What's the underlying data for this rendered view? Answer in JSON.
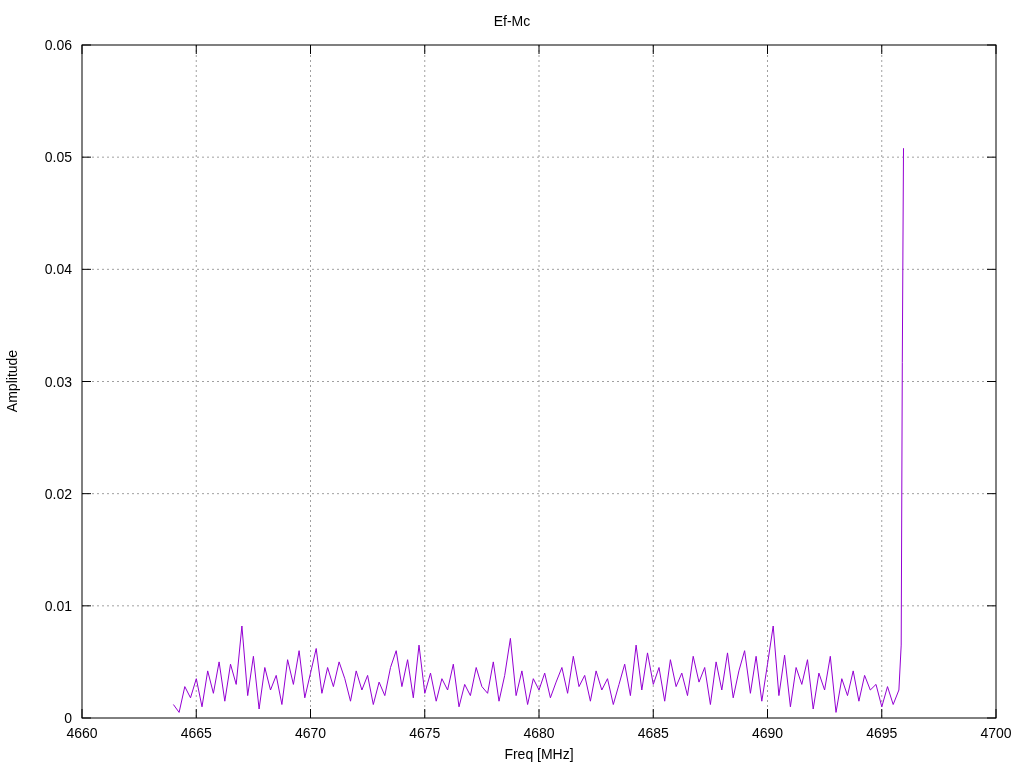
{
  "chart": {
    "chart_data": {
      "type": "line",
      "title": "Ef-Mc",
      "xlabel": "Freq [MHz]",
      "ylabel": "Amplitude",
      "grid": true,
      "xlim": [
        4660,
        4700
      ],
      "ylim": [
        0,
        0.06
      ],
      "xticks": [
        4660,
        4665,
        4670,
        4675,
        4680,
        4685,
        4690,
        4695,
        4700
      ],
      "yticks": [
        0,
        0.01,
        0.02,
        0.03,
        0.04,
        0.05,
        0.06
      ],
      "x": [
        4664,
        4664.25,
        4664.5,
        4664.75,
        4665,
        4665.25,
        4665.5,
        4665.75,
        4666,
        4666.25,
        4666.5,
        4666.75,
        4667,
        4667.25,
        4667.5,
        4667.75,
        4668,
        4668.25,
        4668.5,
        4668.75,
        4669,
        4669.25,
        4669.5,
        4669.75,
        4670,
        4670.25,
        4670.5,
        4670.75,
        4671,
        4671.25,
        4671.5,
        4671.75,
        4672,
        4672.25,
        4672.5,
        4672.75,
        4673,
        4673.25,
        4673.5,
        4673.75,
        4674,
        4674.25,
        4674.5,
        4674.75,
        4675,
        4675.25,
        4675.5,
        4675.75,
        4676,
        4676.25,
        4676.5,
        4676.75,
        4677,
        4677.25,
        4677.5,
        4677.75,
        4678,
        4678.25,
        4678.5,
        4678.75,
        4679,
        4679.25,
        4679.5,
        4679.75,
        4680,
        4680.25,
        4680.5,
        4680.75,
        4681,
        4681.25,
        4681.5,
        4681.75,
        4682,
        4682.25,
        4682.5,
        4682.75,
        4683,
        4683.25,
        4683.5,
        4683.75,
        4684,
        4684.25,
        4684.5,
        4684.75,
        4685,
        4685.25,
        4685.5,
        4685.75,
        4686,
        4686.25,
        4686.5,
        4686.75,
        4687,
        4687.25,
        4687.5,
        4687.75,
        4688,
        4688.25,
        4688.5,
        4688.75,
        4689,
        4689.25,
        4689.5,
        4689.75,
        4690,
        4690.25,
        4690.5,
        4690.75,
        4691,
        4691.25,
        4691.5,
        4691.75,
        4692,
        4692.25,
        4692.5,
        4692.75,
        4693,
        4693.25,
        4693.5,
        4693.75,
        4694,
        4694.25,
        4694.5,
        4694.75,
        4695,
        4695.25,
        4695.5,
        4695.75,
        4695.85,
        4695.9,
        4695.95
      ],
      "series": [
        {
          "color": "#9400d3",
          "values": [
            0.0012,
            0.0005,
            0.0028,
            0.0018,
            0.0035,
            0.001,
            0.0042,
            0.0022,
            0.005,
            0.0015,
            0.0048,
            0.003,
            0.0082,
            0.002,
            0.0055,
            0.0008,
            0.0045,
            0.0025,
            0.0038,
            0.0012,
            0.0052,
            0.003,
            0.006,
            0.0018,
            0.004,
            0.0062,
            0.0022,
            0.0045,
            0.0028,
            0.005,
            0.0035,
            0.0015,
            0.0042,
            0.0025,
            0.0038,
            0.0012,
            0.0032,
            0.002,
            0.0045,
            0.006,
            0.0028,
            0.0052,
            0.0018,
            0.0065,
            0.0022,
            0.004,
            0.0015,
            0.0035,
            0.0025,
            0.0048,
            0.001,
            0.003,
            0.002,
            0.0045,
            0.0028,
            0.0022,
            0.005,
            0.0015,
            0.0038,
            0.0071,
            0.002,
            0.0042,
            0.0012,
            0.0035,
            0.0025,
            0.004,
            0.0018,
            0.0032,
            0.0045,
            0.0022,
            0.0055,
            0.0028,
            0.0038,
            0.0015,
            0.0042,
            0.0025,
            0.0035,
            0.0012,
            0.003,
            0.0048,
            0.002,
            0.0065,
            0.0025,
            0.0058,
            0.003,
            0.0045,
            0.0015,
            0.0052,
            0.0028,
            0.004,
            0.002,
            0.0055,
            0.0032,
            0.0045,
            0.0012,
            0.005,
            0.0025,
            0.0058,
            0.0018,
            0.0042,
            0.006,
            0.0022,
            0.0055,
            0.0015,
            0.0048,
            0.0082,
            0.002,
            0.0056,
            0.001,
            0.0045,
            0.003,
            0.0052,
            0.0008,
            0.004,
            0.0025,
            0.0055,
            0.0005,
            0.0035,
            0.002,
            0.0042,
            0.0015,
            0.0038,
            0.0025,
            0.003,
            0.001,
            0.0028,
            0.0012,
            0.0025,
            0.0065,
            0.0317,
            0.0508
          ]
        }
      ]
    }
  }
}
